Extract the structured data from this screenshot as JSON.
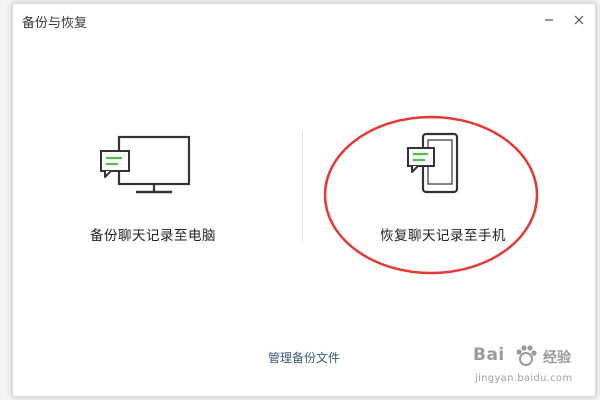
{
  "window": {
    "title": "备份与恢复",
    "minimize_icon": "minimize-icon",
    "close_icon": "close-icon"
  },
  "options": {
    "backup": {
      "label": "备份聊天记录至电脑",
      "icon": "monitor-chat-icon"
    },
    "restore": {
      "label": "恢复聊天记录至手机",
      "icon": "phone-chat-icon"
    }
  },
  "footer": {
    "manage_link": "管理备份文件"
  },
  "watermark": {
    "brand": "Bai",
    "text": "经验",
    "url": "jingyan.baidu.com"
  },
  "colors": {
    "accent_green": "#4cc04a",
    "highlight_red": "#e53935",
    "link_blue": "#3b5a7a"
  }
}
